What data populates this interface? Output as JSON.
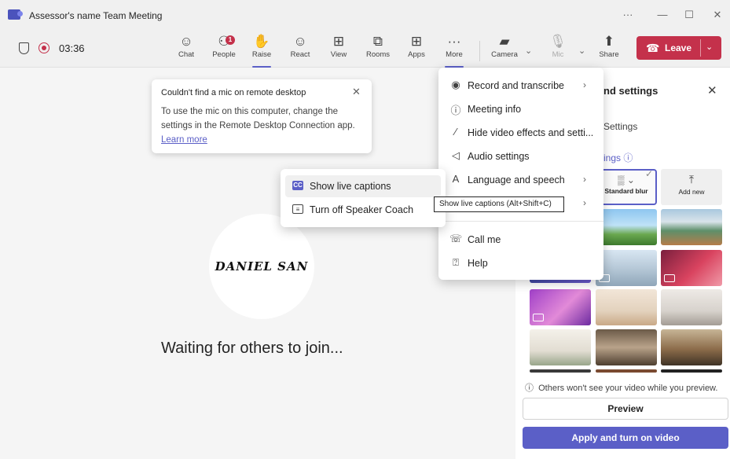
{
  "window": {
    "title": "Assessor's name Team Meeting",
    "controls": [
      "···",
      "—",
      "☐",
      "✕"
    ]
  },
  "toolbar": {
    "timer": "03:36",
    "buttons": [
      {
        "label": "Chat",
        "icon": "chat-icon",
        "glyph": "☺"
      },
      {
        "label": "People",
        "icon": "people-icon",
        "glyph": "👥",
        "badge": "1"
      },
      {
        "label": "Raise",
        "icon": "hand-icon",
        "glyph": "✋"
      },
      {
        "label": "React",
        "icon": "smile-icon",
        "glyph": "☺"
      },
      {
        "label": "View",
        "icon": "grid-icon",
        "glyph": "⊞"
      },
      {
        "label": "Rooms",
        "icon": "rooms-icon",
        "glyph": "▭"
      },
      {
        "label": "Apps",
        "icon": "plus-square-icon",
        "glyph": "⊞"
      },
      {
        "label": "More",
        "icon": "ellipsis-icon",
        "glyph": "···"
      }
    ],
    "camera_label": "Camera",
    "mic_label": "Mic",
    "share_label": "Share",
    "leave_label": "Leave"
  },
  "toast": {
    "title": "Couldn't find a mic on remote desktop",
    "body": "To use the mic on this computer, change the settings in the Remote Desktop Connection app.",
    "link": "Learn more"
  },
  "stage": {
    "avatar_text": "DANIEL SAN",
    "waiting": "Waiting for others to join..."
  },
  "more_menu": {
    "items": [
      {
        "label": "Record and transcribe",
        "icon": "record-icon",
        "glyph": "◉",
        "chevron": true
      },
      {
        "label": "Meeting info",
        "icon": "info-icon",
        "glyph": "ⓘ",
        "chevron": false
      },
      {
        "label": "Hide video effects and setti...",
        "icon": "wand-icon",
        "glyph": "✧",
        "chevron": false
      },
      {
        "label": "Audio settings",
        "icon": "speaker-icon",
        "glyph": "🔈",
        "chevron": false
      },
      {
        "label": "Language and speech",
        "icon": "language-icon",
        "glyph": "A",
        "chevron": true
      },
      {
        "label": "",
        "icon": "",
        "glyph": "",
        "chevron": true
      },
      {
        "label": "Call me",
        "icon": "phone-icon",
        "glyph": "☏",
        "chevron": false
      },
      {
        "label": "Help",
        "icon": "help-icon",
        "glyph": "?",
        "chevron": false
      }
    ]
  },
  "submenu": {
    "items": [
      {
        "label": "Show live captions",
        "icon": "cc-icon",
        "glyph": "CC"
      },
      {
        "label": "Turn off Speaker Coach",
        "icon": "speaker-coach-icon",
        "glyph": "≡"
      }
    ]
  },
  "tooltip": "Show live captions (Alt+Shift+C)",
  "panel": {
    "title": "nd settings",
    "settings_link": "Settings",
    "section": "ings ⓘ",
    "blur_label": "Standard blur",
    "add_label": "Add new",
    "info": "Others won't see your video while you preview.",
    "preview": "Preview",
    "apply": "Apply and turn on video"
  },
  "colors": {
    "accent": "#5b5fc7",
    "leave": "#c4314b",
    "record": "#c4314b"
  }
}
